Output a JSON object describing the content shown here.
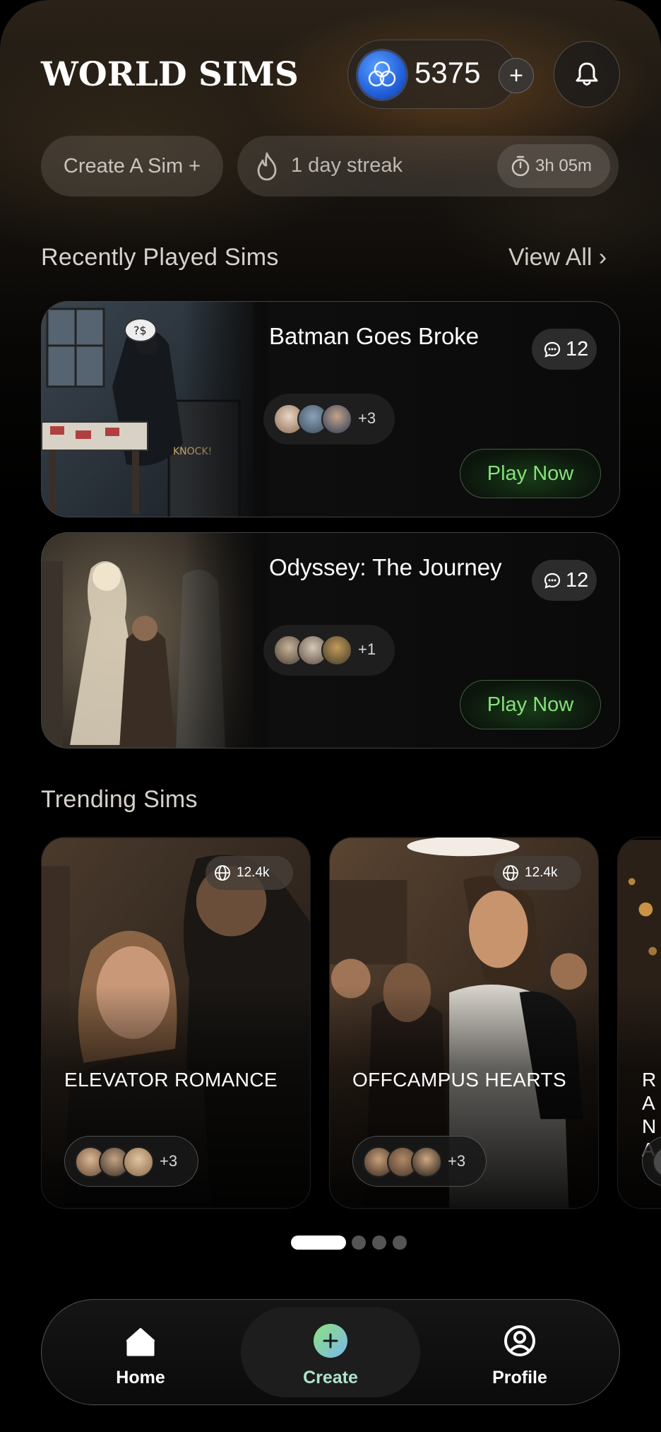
{
  "header": {
    "app_title": "WORLD SIMS",
    "coins": "5375",
    "coin_plus": "+"
  },
  "chips": {
    "create_sim": "Create A Sim +",
    "streak": "1 day streak",
    "timer": "3h 05m"
  },
  "recent": {
    "section_title": "Recently Played Sims",
    "view_all": "View All ›",
    "cards": [
      {
        "title": "Batman Goes Broke",
        "chats": "12",
        "more_avatars": "+3",
        "play_label": "Play Now"
      },
      {
        "title": "Odyssey: The Journey",
        "chats": "12",
        "more_avatars": "+1",
        "play_label": "Play Now"
      }
    ]
  },
  "trending": {
    "section_title": "Trending Sims",
    "cards": [
      {
        "title": "ELEVATOR ROMANCE",
        "views": "12.4k",
        "more_avatars": "+3"
      },
      {
        "title": "OFFCAMPUS HEARTS",
        "views": "12.4k",
        "more_avatars": "+3"
      },
      {
        "title": "RA NA",
        "views": "",
        "more_avatars": ""
      }
    ]
  },
  "carousel": {
    "page": 1,
    "pages": 4
  },
  "nav": {
    "home": "Home",
    "create": "Create",
    "profile": "Profile"
  },
  "colors": {
    "accent_green": "#86e07a",
    "coin_blue": "#1f5bd6",
    "create_gradient": [
      "#6fd18a",
      "#7cc4e8"
    ]
  }
}
